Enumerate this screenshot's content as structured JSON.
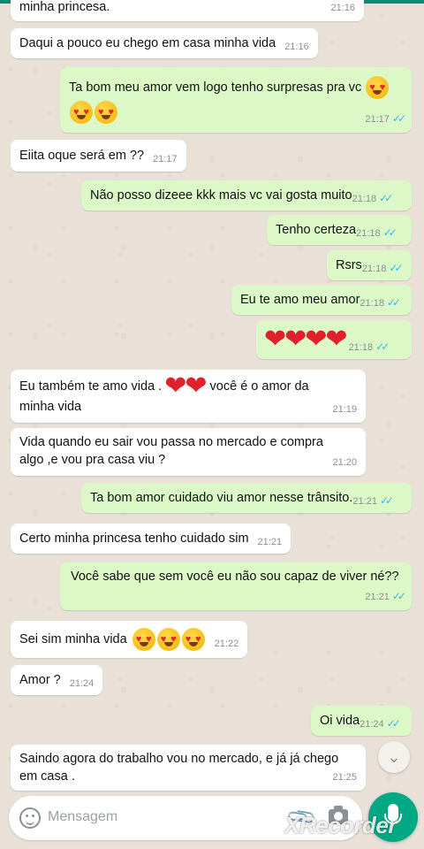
{
  "chat": {
    "messages": [
      {
        "dir": "in",
        "text": "minha princesa.",
        "time": "21:16"
      },
      {
        "dir": "in",
        "text": "Daqui a pouco eu chego em casa minha vida",
        "time": "21:16"
      },
      {
        "dir": "out",
        "text": "Ta bom meu amor vem logo tenho surpresas pra vc",
        "emoji": [
          "heart-eyes",
          "heart-eyes",
          "heart-eyes"
        ],
        "time": "21:17",
        "status": "read"
      },
      {
        "dir": "in",
        "text": "Eiita oque será em ??",
        "time": "21:17"
      },
      {
        "dir": "out",
        "text": "Não posso dizeee  kkk mais vc vai gosta muito",
        "time": "21:18",
        "status": "read"
      },
      {
        "dir": "out",
        "text": "Tenho certeza",
        "time": "21:18",
        "status": "read"
      },
      {
        "dir": "out",
        "text": "Rsrs",
        "time": "21:18",
        "status": "read"
      },
      {
        "dir": "out",
        "text": "Eu te amo meu amor",
        "time": "21:18",
        "status": "read"
      },
      {
        "dir": "out",
        "text": "",
        "emoji": [
          "red-heart",
          "red-heart",
          "red-heart",
          "red-heart"
        ],
        "time": "21:18",
        "status": "read"
      },
      {
        "dir": "in",
        "text": "Eu também te amo vida .",
        "text_after": "você é o amor da",
        "text_line2": "minha vida",
        "emoji": [
          "red-heart",
          "red-heart"
        ],
        "time": "21:19"
      },
      {
        "dir": "in",
        "text": "Vida quando eu sair vou passa no mercado e compra",
        "text_line2": "algo ,e vou pra casa viu ?",
        "time": "21:20"
      },
      {
        "dir": "out",
        "text": "Ta bom amor cuidado viu amor nesse trânsito.",
        "time": "21:21",
        "status": "read"
      },
      {
        "dir": "in",
        "text": "Certo minha princesa tenho cuidado sim",
        "time": "21:21"
      },
      {
        "dir": "out",
        "text": "Você sabe que sem você eu não sou capaz de viver né??",
        "time": "21:21",
        "status": "read"
      },
      {
        "dir": "in",
        "text": "Sei sim minha vida",
        "emoji": [
          "heart-eyes",
          "heart-eyes",
          "heart-eyes"
        ],
        "time": "21:22"
      },
      {
        "dir": "in",
        "text": "Amor ?",
        "time": "21:24"
      },
      {
        "dir": "out",
        "text": "Oi vida",
        "time": "21:24",
        "status": "read"
      },
      {
        "dir": "in",
        "text": "Saindo agora do trabalho vou no mercado, e já já chego",
        "text_line2": "em casa .",
        "time": "21:25"
      }
    ]
  },
  "input": {
    "placeholder": "Mensagem"
  },
  "icons": {
    "emoji": "smiley-icon",
    "attach": "paperclip-icon",
    "camera": "camera-icon",
    "mic": "microphone-icon",
    "scroll": "double-chevron-down-icon",
    "read": "double-check-icon"
  },
  "colors": {
    "incoming": "#ffffff",
    "outgoing": "#dcf8c6",
    "accent": "#00a884",
    "ticks": "#34b7f1"
  },
  "watermark": "XRecorder"
}
